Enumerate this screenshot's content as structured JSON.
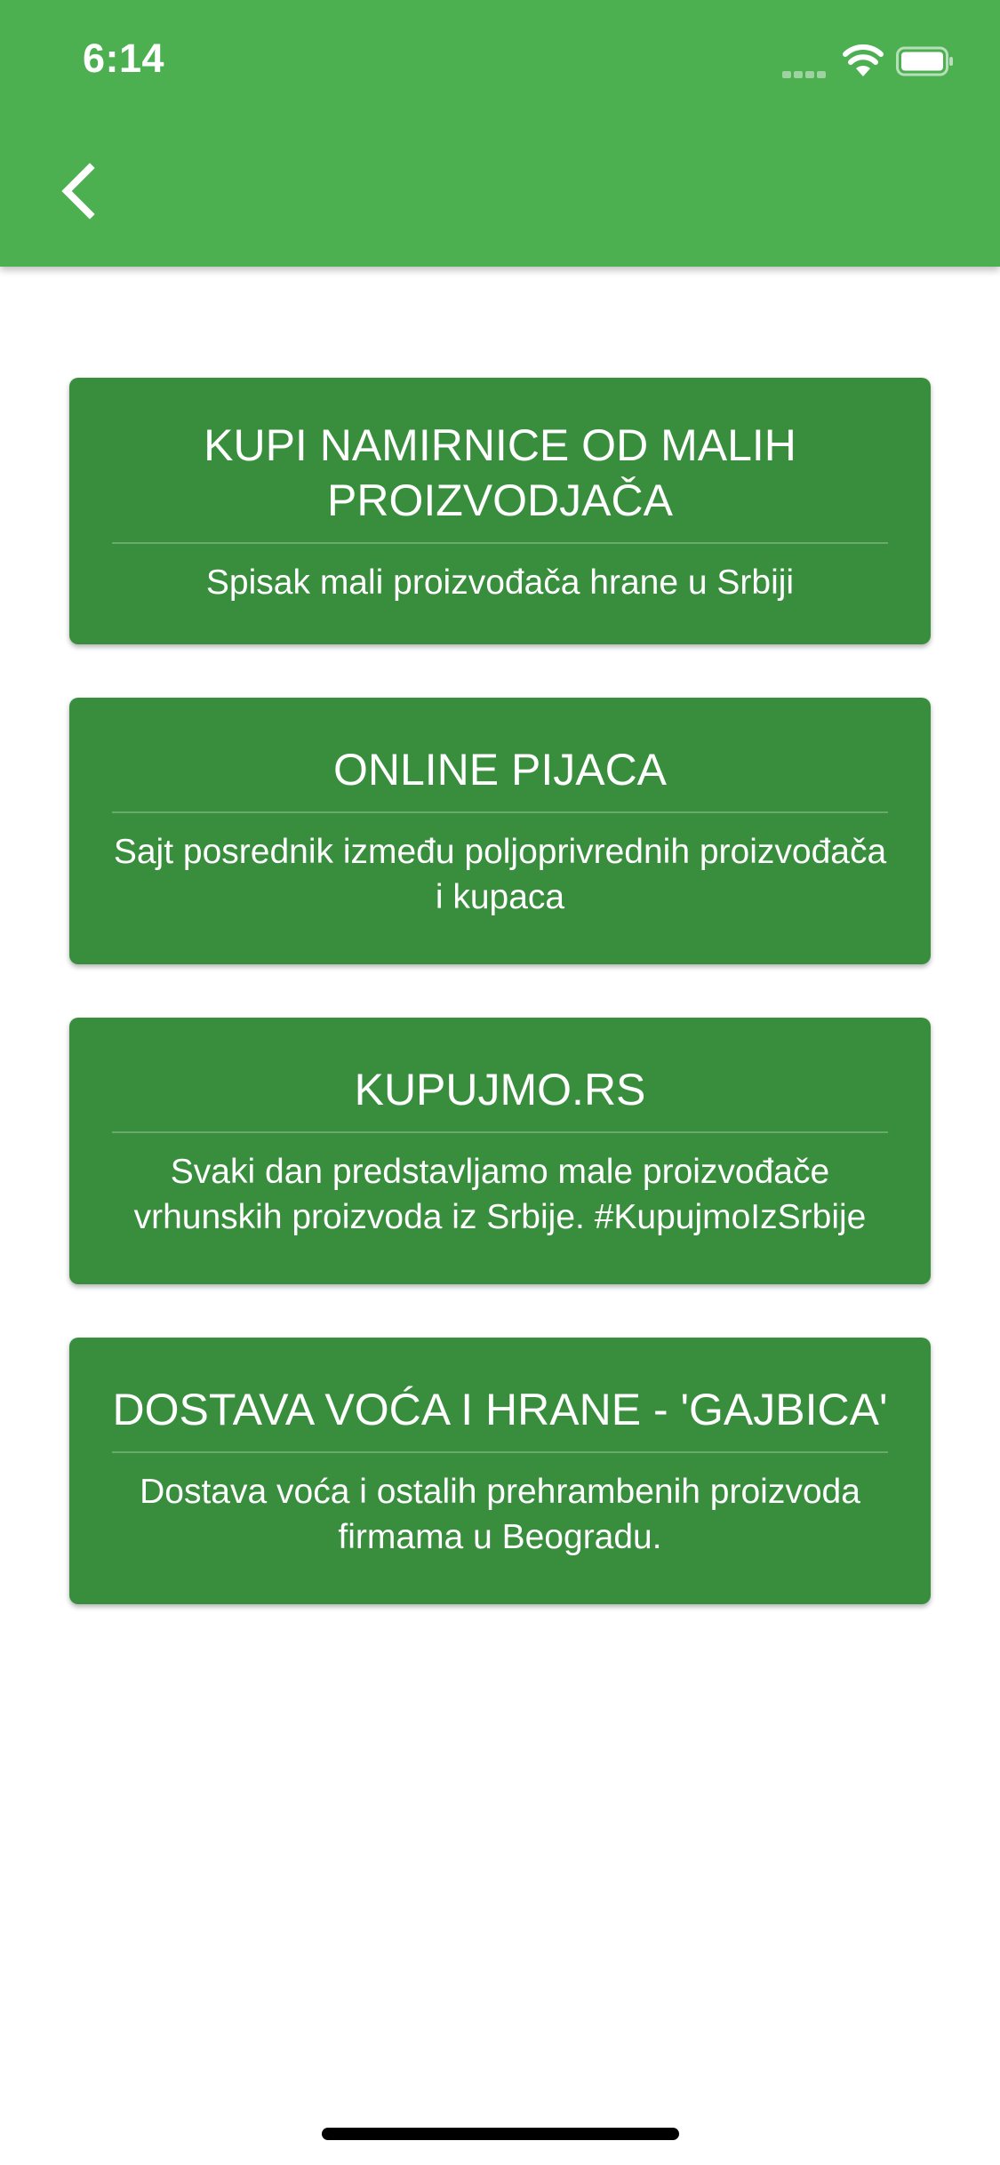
{
  "status_bar": {
    "time": "6:14"
  },
  "app_bar": {
    "back_icon": "chevron-left-icon"
  },
  "colors": {
    "app_bar": "#4caf50",
    "card": "#388e3c",
    "text": "#ffffff"
  },
  "cards": [
    {
      "title": "KUPI NAMIRNICE OD MALIH PROIZVODJAČA",
      "subtitle": "Spisak mali proizvođača hrane u Srbiji"
    },
    {
      "title": "ONLINE PIJACA",
      "subtitle": "Sajt posrednik između poljoprivrednih proizvođača i kupaca"
    },
    {
      "title": "KUPUJMO.RS",
      "subtitle": "Svaki dan predstavljamo male proizvođače vrhunskih proizvoda iz Srbije. #KupujmoIzSrbije"
    },
    {
      "title": "DOSTAVA VOĆA I HRANE - 'GAJBICA'",
      "subtitle": "Dostava voća i ostalih prehrambenih proizvoda firmama u Beogradu."
    }
  ]
}
